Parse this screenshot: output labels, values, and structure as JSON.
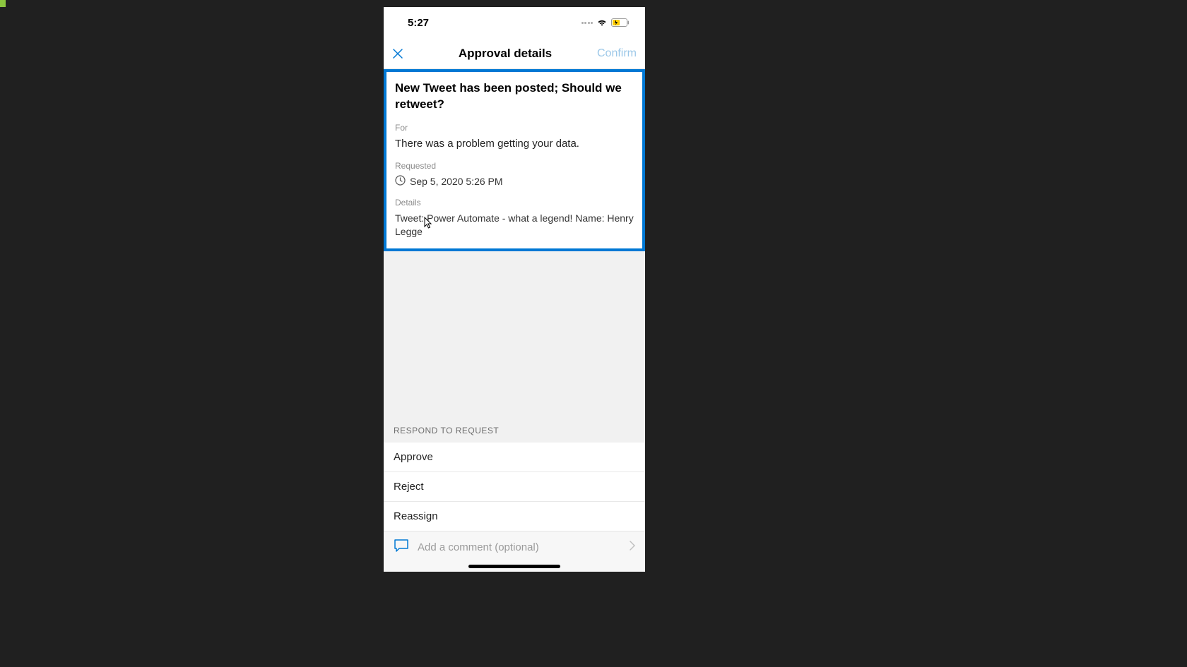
{
  "status": {
    "time": "5:27"
  },
  "nav": {
    "title": "Approval details",
    "confirm_label": "Confirm"
  },
  "approval": {
    "title": "New Tweet has been posted; Should we retweet?",
    "for_label": "For",
    "for_value": "There was a problem getting your data.",
    "requested_label": "Requested",
    "requested_value": "Sep 5, 2020 5:26 PM",
    "details_label": "Details",
    "details_value": "Tweet: Power Automate - what a legend! Name: Henry Legge"
  },
  "respond": {
    "header": "RESPOND TO REQUEST",
    "actions": {
      "approve": "Approve",
      "reject": "Reject",
      "reassign": "Reassign"
    }
  },
  "comment": {
    "placeholder": "Add a comment (optional)"
  }
}
